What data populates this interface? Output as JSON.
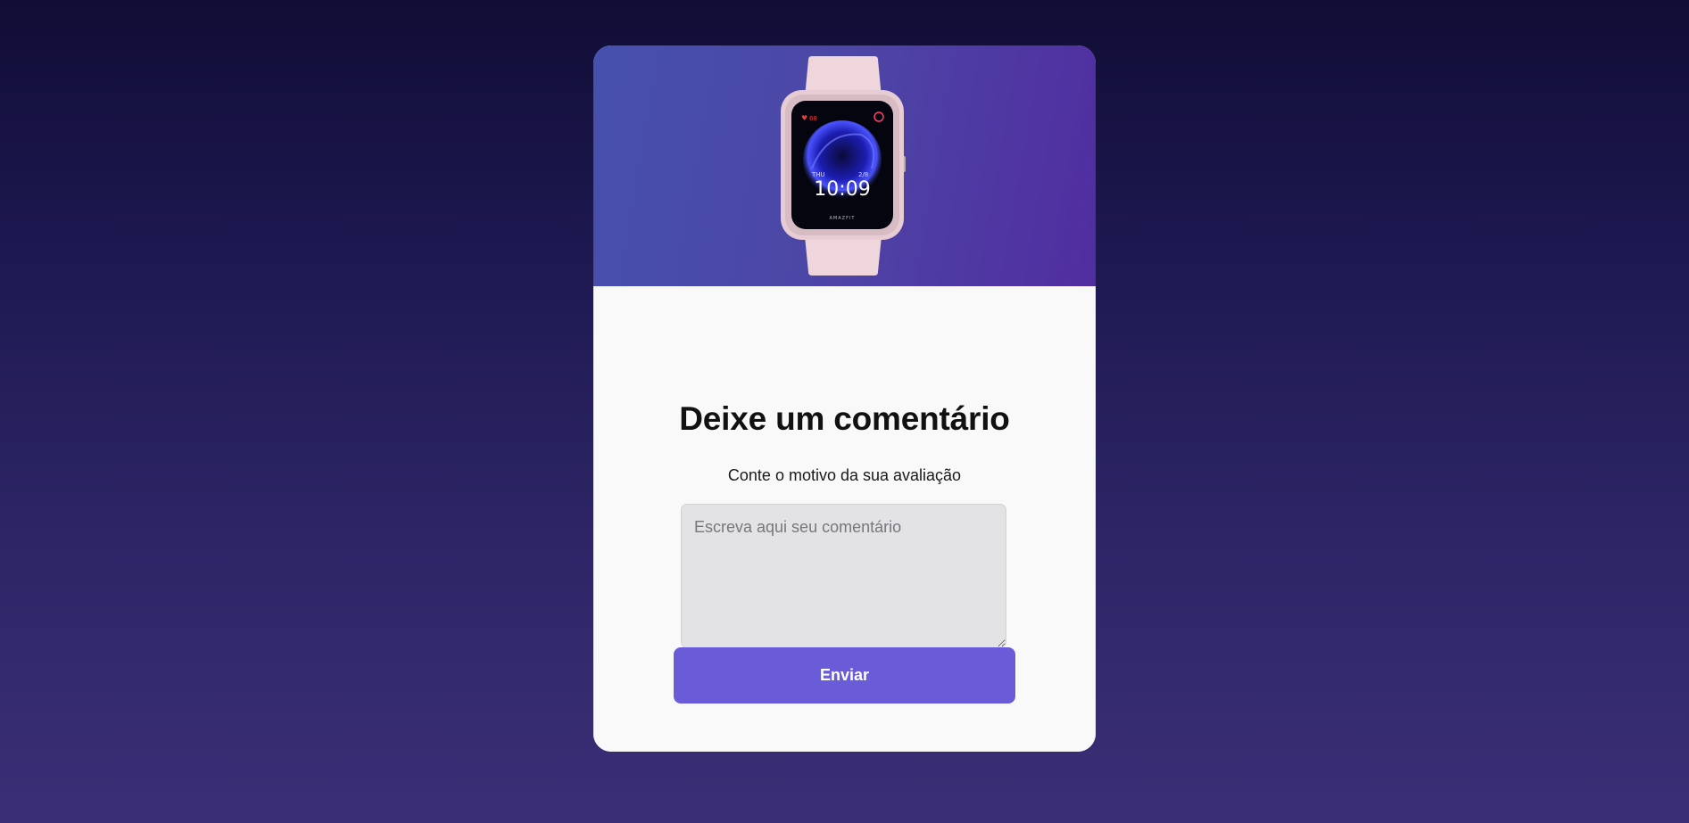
{
  "card": {
    "hero": {
      "image": "smartwatch-product-photo",
      "watch_brand": "AMAZFIT",
      "watch_time": "10:09",
      "watch_day": "THU",
      "watch_date": "2/8",
      "watch_heart_rate": "68"
    },
    "title": "Deixe um comentário",
    "subtitle": "Conte o motivo da sua avaliação",
    "comment": {
      "placeholder": "Escreva aqui seu comentário",
      "value": ""
    },
    "submit_label": "Enviar"
  },
  "colors": {
    "background_top": "#110d36",
    "background_bottom": "#3b2f77",
    "hero_gradient_start": "#4650ad",
    "hero_gradient_end": "#512da0",
    "accent_button": "#6a5cd9",
    "card_background": "#f9f9f9",
    "input_background": "#e3e2e4",
    "watch_strap": "#eed6dc"
  }
}
